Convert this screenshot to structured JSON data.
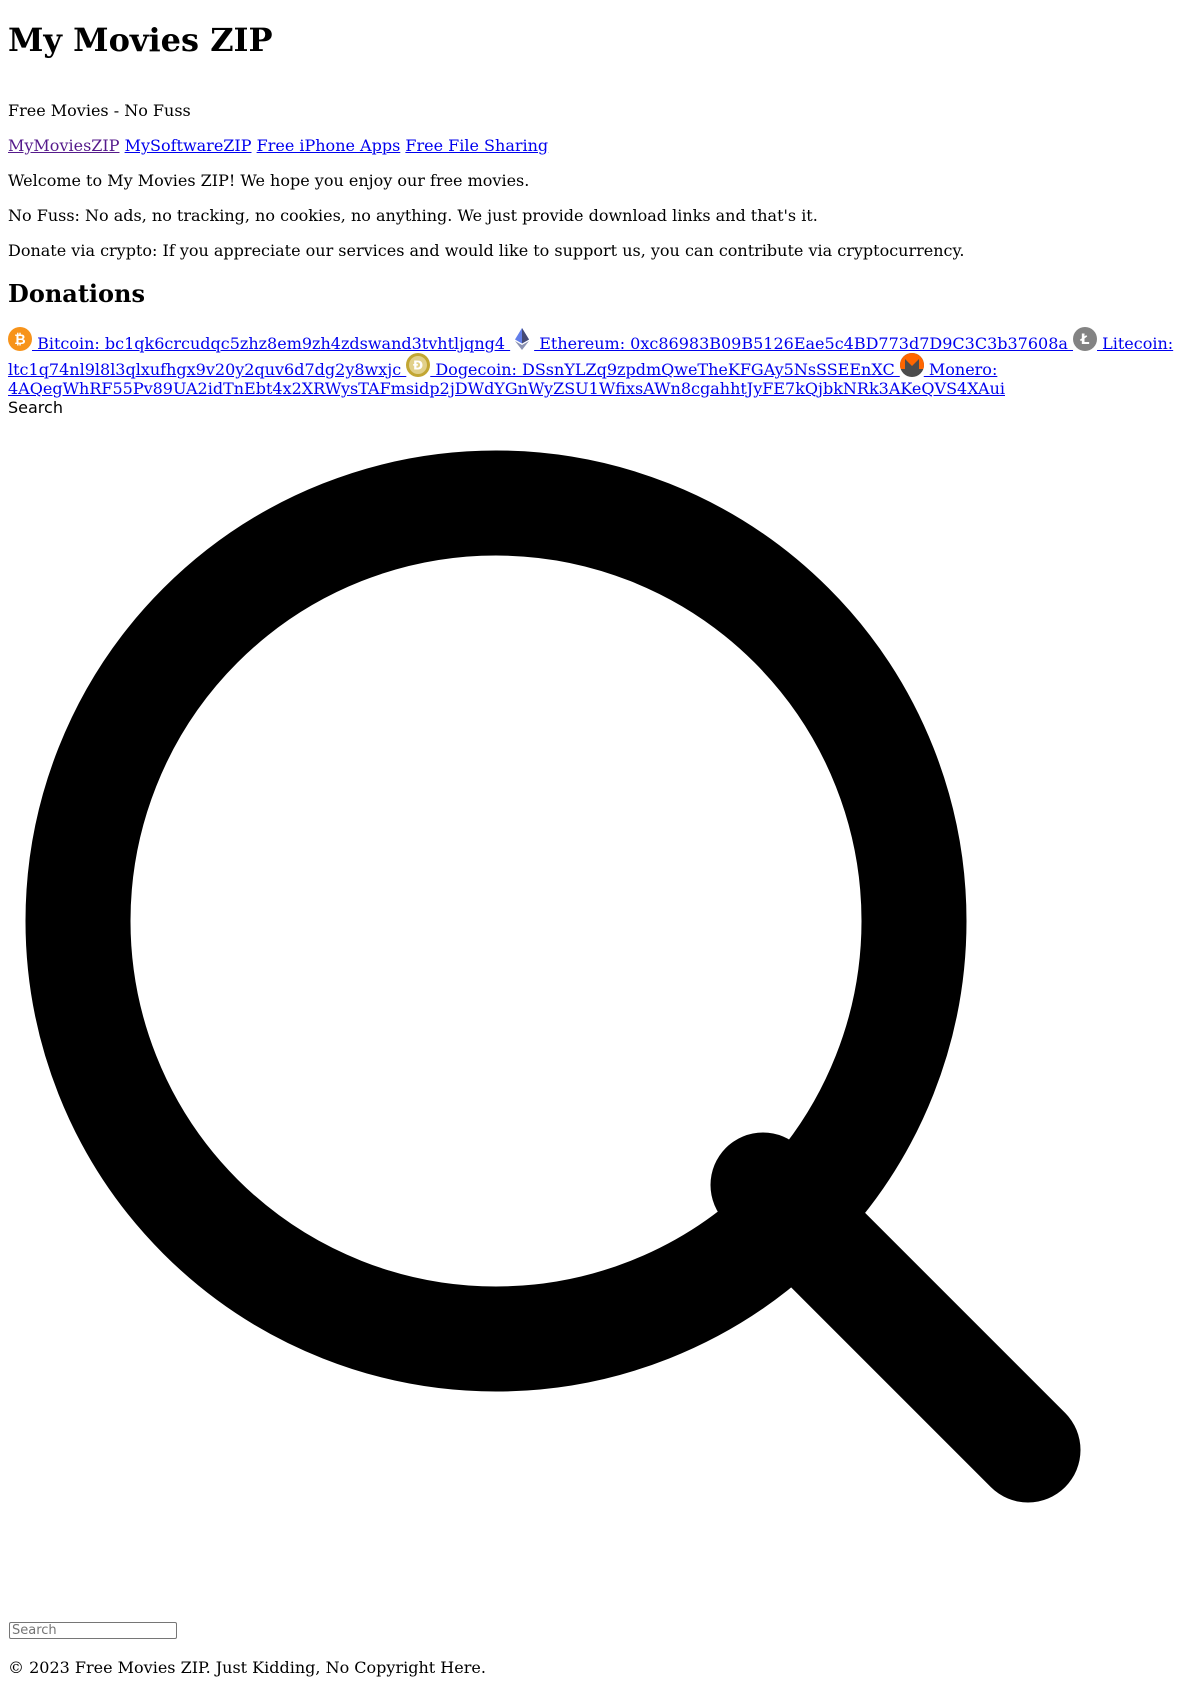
{
  "header": {
    "title": "My Movies ZIP",
    "tagline": "Free Movies - No Fuss"
  },
  "nav": {
    "links": [
      {
        "label": "MyMoviesZIP",
        "visited": true
      },
      {
        "label": "MySoftwareZIP",
        "visited": false
      },
      {
        "label": "Free iPhone Apps",
        "visited": false
      },
      {
        "label": "Free File Sharing",
        "visited": false
      }
    ]
  },
  "intro": {
    "welcome": "Welcome to My Movies ZIP! We hope you enjoy our free movies.",
    "no_fuss": "No Fuss: No ads, no tracking, no cookies, no anything. We just provide download links and that's it.",
    "donate": "Donate via crypto: If you appreciate our services and would like to support us, you can contribute via cryptocurrency."
  },
  "donations": {
    "heading": "Donations",
    "coins": [
      {
        "icon": "bitcoin-icon",
        "color": "#f7931a",
        "label": " Bitcoin: bc1qk6crcudqc5zhz8em9zh4zdswand3tvhtljqng4 "
      },
      {
        "icon": "ethereum-icon",
        "color": "#627eea",
        "label": " Ethereum: 0xc86983B09B5126Eae5c4BD773d7D9C3C3b37608a "
      },
      {
        "icon": "litecoin-icon",
        "color": "#838383",
        "label": " Litecoin: ltc1q74nl9l8l3qlxufhgx9v20y2quv6d7dg2y8wxjc "
      },
      {
        "icon": "dogecoin-icon",
        "color": "#c2a633",
        "label": " Dogecoin: DSsnYLZq9zpdmQweTheKFGAy5NsSSEEnXC "
      },
      {
        "icon": "monero-icon",
        "color": "#ff6600",
        "label": " Monero: 4AQegWhRF55Pv89UA2idTnEbt4x2XRWysTAFmsidp2jDWdYGnWyZSU1WfixsAWn8cgahhtJyFE7kQjbkNRk3AKeQVS4XAui"
      }
    ]
  },
  "search": {
    "label": "Search",
    "placeholder": "Search",
    "value": ""
  },
  "footer": {
    "text": "© 2023 Free Movies ZIP. Just Kidding, No Copyright Here."
  }
}
